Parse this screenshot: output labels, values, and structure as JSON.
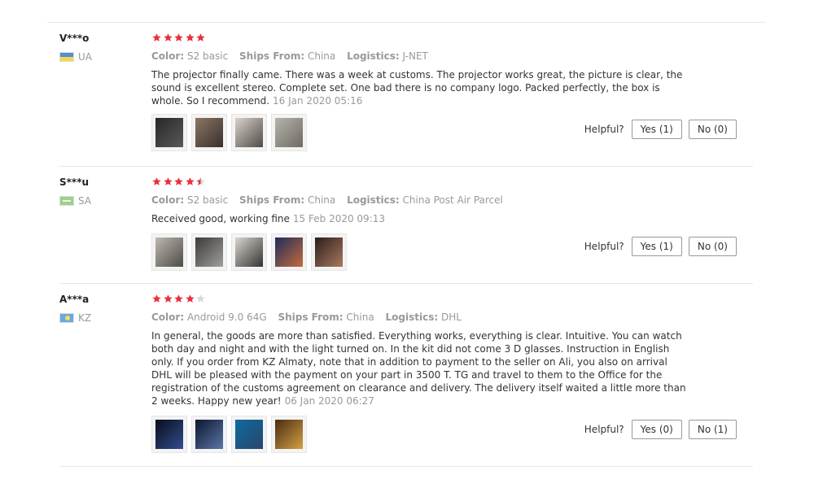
{
  "reviews": [
    {
      "user": "V***o",
      "country": "UA",
      "rating": 5,
      "color_label": "Color:",
      "color": "S2 basic",
      "ships_label": "Ships From:",
      "ships_from": "China",
      "logistics_label": "Logistics:",
      "logistics": "J-NET",
      "text": "The projector finally came. There was a week at customs. The projector works great, the picture is clear, the sound is excellent stereo. Complete set. One bad there is no company logo. Packed perfectly, the box is whole. So I recommend.",
      "date": "16 Jan 2020 05:16",
      "helpful_label": "Helpful?",
      "yes": "Yes (1)",
      "no": "No (0)",
      "photos": [
        "photo-1",
        "photo-2",
        "photo-3",
        "photo-4"
      ]
    },
    {
      "user": "S***u",
      "country": "SA",
      "rating": 4.5,
      "color_label": "Color:",
      "color": "S2 basic",
      "ships_label": "Ships From:",
      "ships_from": "China",
      "logistics_label": "Logistics:",
      "logistics": "China Post Air Parcel",
      "text": "Received good, working fine",
      "date": "15 Feb 2020 09:13",
      "helpful_label": "Helpful?",
      "yes": "Yes (1)",
      "no": "No (0)",
      "photos": [
        "photo-1",
        "photo-2",
        "photo-3",
        "photo-4",
        "photo-5"
      ]
    },
    {
      "user": "A***a",
      "country": "KZ",
      "rating": 4,
      "color_label": "Color:",
      "color": "Android 9.0 64G",
      "ships_label": "Ships From:",
      "ships_from": "China",
      "logistics_label": "Logistics:",
      "logistics": "DHL",
      "text": "In general, the goods are more than satisfied. Everything works, everything is clear. Intuitive. You can watch both day and night and with the light turned on. In the kit did not come 3 D glasses. Instruction in English only. If you order from KZ Almaty, note that in addition to payment to the seller on Ali, you also on arrival DHL will be pleased with the payment on your part in 3500 T. TG and travel to them to the Office for the registration of the customs agreement on clearance and delivery. The delivery itself waited a little more than 2 weeks. Happy new year!",
      "date": "06 Jan 2020 06:27",
      "helpful_label": "Helpful?",
      "yes": "Yes (0)",
      "no": "No (1)",
      "photos": [
        "photo-1",
        "photo-2",
        "photo-3",
        "photo-4"
      ]
    }
  ],
  "colors": {
    "star": "#e8323e",
    "star_empty": "#d9d9d9",
    "meta_text": "#999999",
    "body_text": "#333333",
    "divider": "#e8e8e8"
  }
}
